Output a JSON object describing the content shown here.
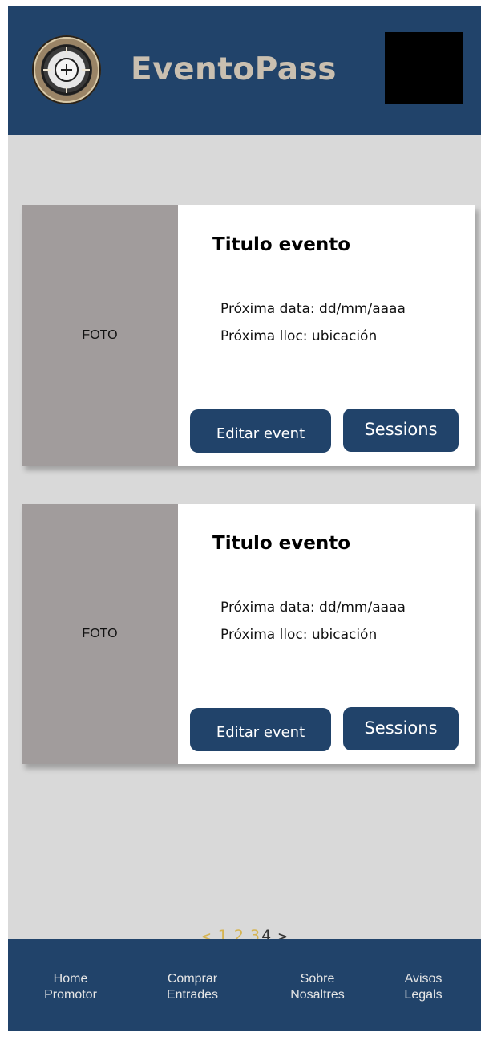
{
  "header": {
    "brand": "EventoPass"
  },
  "events": [
    {
      "photo_label": "FOTO",
      "title": "Titulo evento",
      "next_date": "Próxima data: dd/mm/aaaa",
      "next_place": "Próxima lloc: ubicación",
      "edit_label": "Editar event",
      "sessions_label": "Sessions"
    },
    {
      "photo_label": "FOTO",
      "title": "Titulo evento",
      "next_date": "Próxima data: dd/mm/aaaa",
      "next_place": "Próxima lloc: ubicación",
      "edit_label": "Editar event",
      "sessions_label": "Sessions"
    }
  ],
  "pagination": {
    "prev": "<",
    "pages": [
      "1",
      "2",
      "3",
      "4"
    ],
    "current": "4",
    "next": ">"
  },
  "footer": {
    "items": [
      {
        "line1": "Home",
        "line2": "Promotor"
      },
      {
        "line1": "Comprar",
        "line2": "Entrades"
      },
      {
        "line1": "Sobre",
        "line2": "Nosaltres"
      },
      {
        "line1": "Avisos",
        "line2": "Legals"
      }
    ]
  },
  "colors": {
    "primary": "#21436a",
    "page_bg": "#d9d9d9",
    "photo_bg": "#a19c9c",
    "brand_text": "#c9bfb0",
    "page_link": "#d6b451"
  },
  "icons": {
    "logo": "seal-logo-icon",
    "menu": "menu-placeholder-box"
  }
}
